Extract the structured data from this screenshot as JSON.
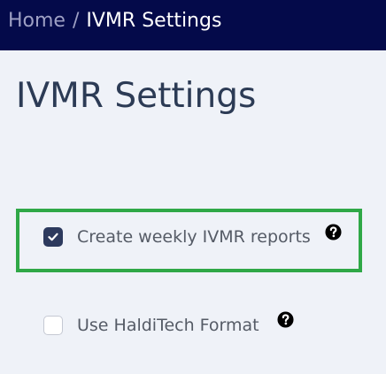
{
  "breadcrumb": {
    "home": "Home",
    "separator": "/",
    "current": "IVMR Settings"
  },
  "page": {
    "title": "IVMR Settings"
  },
  "options": [
    {
      "label": "Create weekly IVMR reports",
      "checked": true,
      "highlighted": true,
      "icon": "help-icon"
    },
    {
      "label": "Use HaldiTech Format",
      "checked": false,
      "highlighted": false,
      "icon": "help-icon"
    }
  ],
  "colors": {
    "topbar": "#040a4a",
    "background": "#eff2f8",
    "highlight": "#2fa847",
    "checkbox_checked": "#2d3a5e",
    "title": "#2c3b55"
  }
}
